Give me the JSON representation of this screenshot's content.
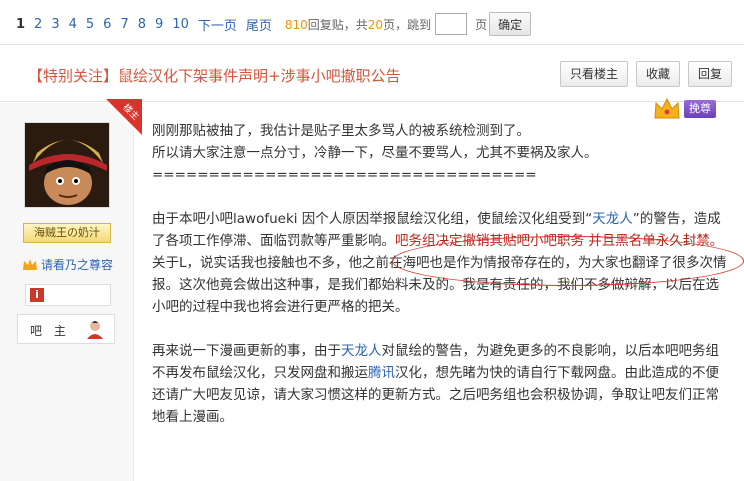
{
  "pager": {
    "pages": [
      "1",
      "2",
      "3",
      "4",
      "5",
      "6",
      "7",
      "8",
      "9",
      "10"
    ],
    "current": "1",
    "next_label": "下一页",
    "last_label": "尾页",
    "reply_count": "810",
    "reply_suffix": "回复贴，共",
    "page_count": "20",
    "page_suffix": "页，跳到",
    "jump_input": "",
    "jump_unit": "页",
    "confirm_label": "确定"
  },
  "titlebar": {
    "tag": "【特别关注】",
    "title": "鼠绘汉化下架事件声明+涉事小吧撤职公告",
    "only_host_label": "只看楼主",
    "collect_label": "收藏",
    "reply_label": "回复"
  },
  "author": {
    "corner_badge": "楼主",
    "user_tag": "海贼王の奶汁",
    "member_text": "请看乃之尊容",
    "level_icon": "i",
    "role": "吧 主"
  },
  "vip": {
    "label": "挽尊"
  },
  "post": {
    "p1": "刚刚那贴被抽了，我估计是贴子里太多骂人的被系统检测到了。",
    "p2": "所以请大家注意一点分寸，冷静一下，尽量不要骂人，尤其不要祸及家人。",
    "divider": "==================================",
    "p3_a": "由于本吧小吧lawofueki 因个人原因举报鼠绘汉化组，使鼠绘汉化组受到“",
    "p3_link": "天龙人",
    "p3_b": "”的警告，造成了各项工作停滞、面临罚款等严重影响。",
    "p3_red": "吧务组决定撤销其贴吧小吧职务 并且黑名单永久封禁。",
    "p4": "关于L，说实话我也接触也不多，他之前在海吧也是作为情报帝存在的，为大家也翻译了很多次情报。这次他竟会做出这种事，是我们都始料未及的。我是有责任的，我们不多做辩解，以后在选小吧的过程中我也将会进行更严格的把关。",
    "p5_a": "再来说一下漫画更新的事，由于",
    "p5_link1": "天龙人",
    "p5_b": "对鼠绘的警告，为避免更多的不良影响，以后本吧吧务组不再发布鼠绘汉化，只发网盘和搬运",
    "p5_link2": "腾讯",
    "p5_c": "汉化，想先睹为快的请自行下载网盘。由此造成的不便还请广大吧友见谅，请大家习惯这样的更新方式。之后吧务组也会积极协调，争取让吧友们正常地看上漫画。"
  }
}
